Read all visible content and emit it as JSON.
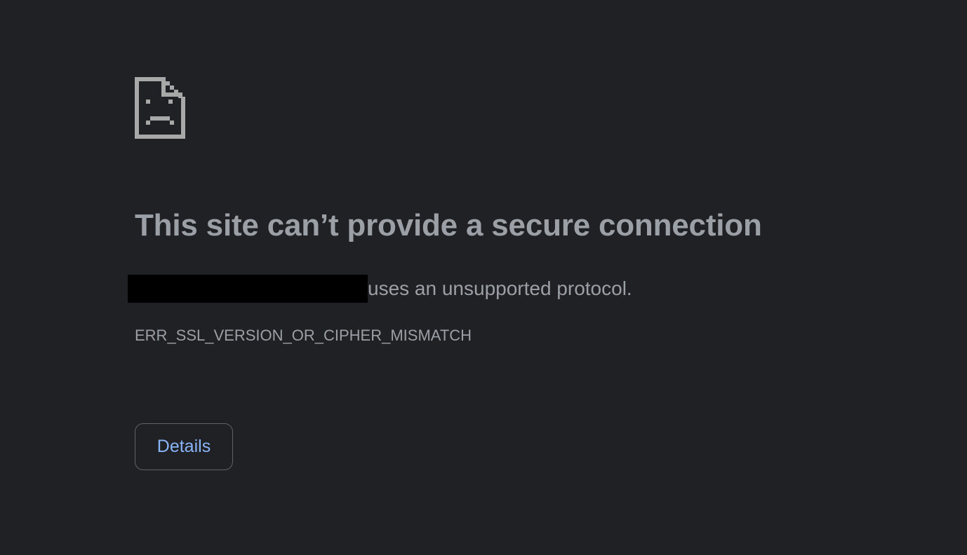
{
  "icon": {
    "name": "sad-page-icon",
    "color": "#a8a8a8"
  },
  "heading": "This site can’t provide a secure connection",
  "summary": {
    "text": "uses an unsupported protocol."
  },
  "error_code": "ERR_SSL_VERSION_OR_CIPHER_MISMATCH",
  "details_button": {
    "label": "Details"
  },
  "colors": {
    "background": "#202124",
    "text": "#9aa0a6",
    "link": "#8ab4f8",
    "button_border": "#5f6368"
  }
}
